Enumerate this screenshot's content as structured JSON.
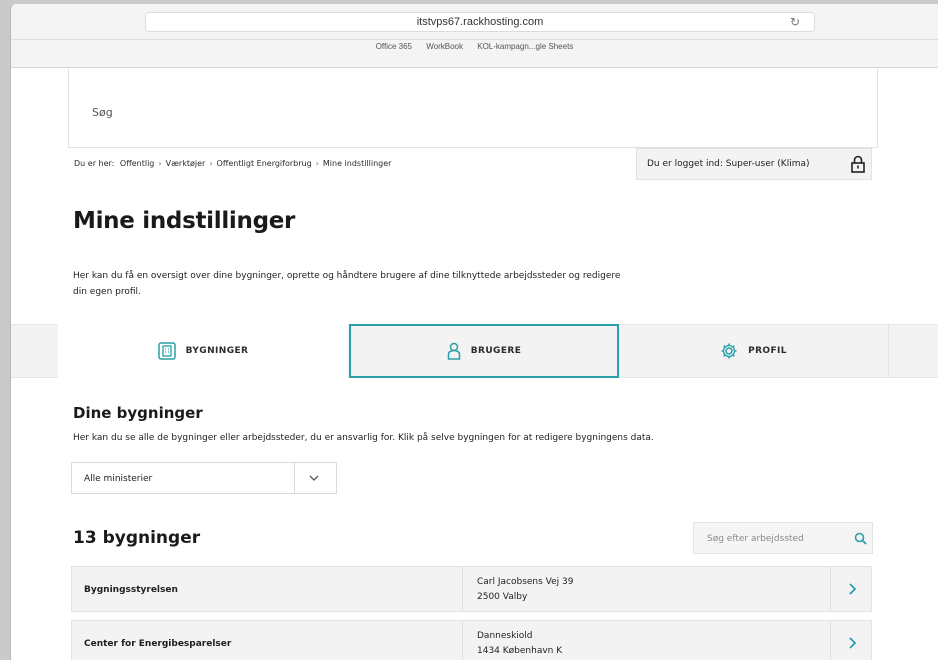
{
  "browser": {
    "url": "itstvps67.rackhosting.com",
    "bookmarks": [
      "Office 365",
      "WorkBook",
      "KOL-kampagn...gle Sheets"
    ]
  },
  "header": {
    "search_label": "Søg"
  },
  "breadcrumb": {
    "prefix": "Du er her:",
    "items": [
      "Offentlig",
      "Værktøjer",
      "Offentligt Energiforbrug",
      "Mine indstillinger"
    ]
  },
  "login": {
    "text": "Du er logget ind: Super-user (Klima)"
  },
  "page": {
    "title": "Mine indstillinger",
    "intro": "Her kan du få en oversigt over dine bygninger, oprette og håndtere brugere af dine tilknyttede arbejdssteder og redigere din egen profil."
  },
  "tabs": [
    {
      "label": "BYGNINGER",
      "icon": "building-icon"
    },
    {
      "label": "BRUGERE",
      "icon": "user-icon"
    },
    {
      "label": "PROFIL",
      "icon": "gear-icon"
    }
  ],
  "buildings": {
    "title": "Dine bygninger",
    "description": "Her kan du se alle de bygninger eller arbejdssteder, du er ansvarlig for. Klik på selve bygningen for at redigere bygningens data.",
    "filter_value": "Alle ministerier",
    "count_title": "13 bygninger",
    "search_placeholder": "Søg efter arbejdssted",
    "rows": [
      {
        "name": "Bygningsstyrelsen",
        "address1": "Carl Jacobsens Vej 39",
        "address2": "2500 Valby"
      },
      {
        "name": "Center for Energibesparelser",
        "address1": "Danneskiold",
        "address2": "1434 København K"
      }
    ]
  },
  "colors": {
    "accent": "#2a9fa7",
    "row_bg": "#f3f3f3"
  }
}
